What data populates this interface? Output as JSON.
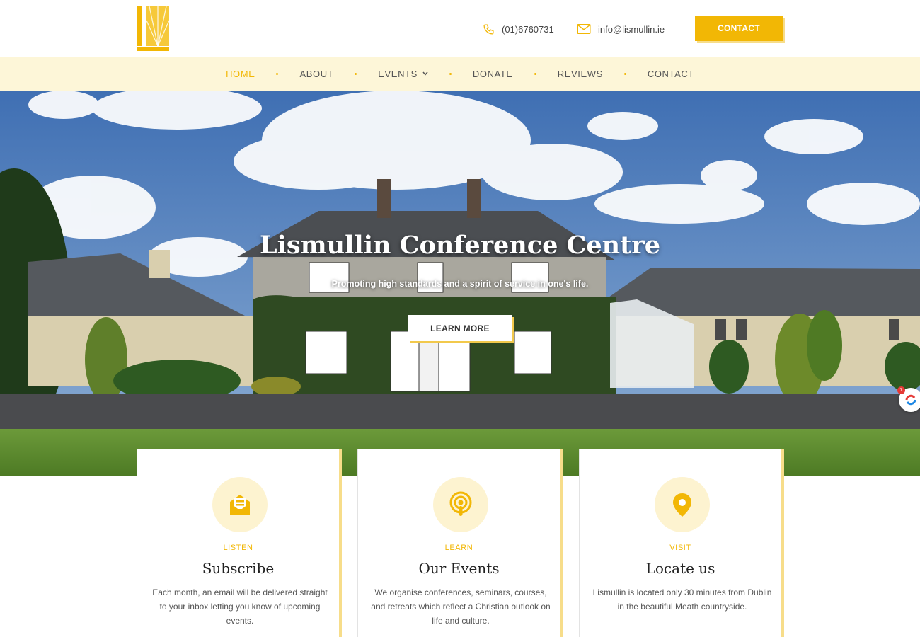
{
  "header": {
    "logo_icon": "lismullin-logo",
    "phone": "(01)6760731",
    "email": "info@lismullin.ie",
    "contact_button": "CONTACT"
  },
  "nav": {
    "items": [
      {
        "label": "HOME",
        "active": true
      },
      {
        "label": "ABOUT"
      },
      {
        "label": "EVENTS",
        "has_dropdown": true
      },
      {
        "label": "DONATE"
      },
      {
        "label": "REVIEWS"
      },
      {
        "label": "CONTACT"
      }
    ]
  },
  "hero": {
    "title": "Lismullin Conference Centre",
    "subtitle": "Promoting high standards and a spirit of service in one's life.",
    "button": "LEARN MORE"
  },
  "cards": [
    {
      "icon": "envelope-open-icon",
      "kicker": "LISTEN",
      "title": "Subscribe",
      "text": "Each month, an email will be delivered straight to your inbox letting you know of upcoming events."
    },
    {
      "icon": "podcast-icon",
      "kicker": "LEARN",
      "title": "Our Events",
      "text": "We organise conferences, seminars, courses, and retreats which reflect a Christian outlook on life and culture."
    },
    {
      "icon": "map-pin-icon",
      "kicker": "VISIT",
      "title": "Locate us",
      "text": "Lismullin is located only 30 minutes from Dublin in the beautiful Meath countryside."
    }
  ],
  "widget": {
    "badge": "7",
    "icon": "chat-widget-icon"
  },
  "colors": {
    "accent": "#f2b705",
    "nav_bg": "#fdf6d8",
    "accent_light": "#fdf3d0"
  }
}
